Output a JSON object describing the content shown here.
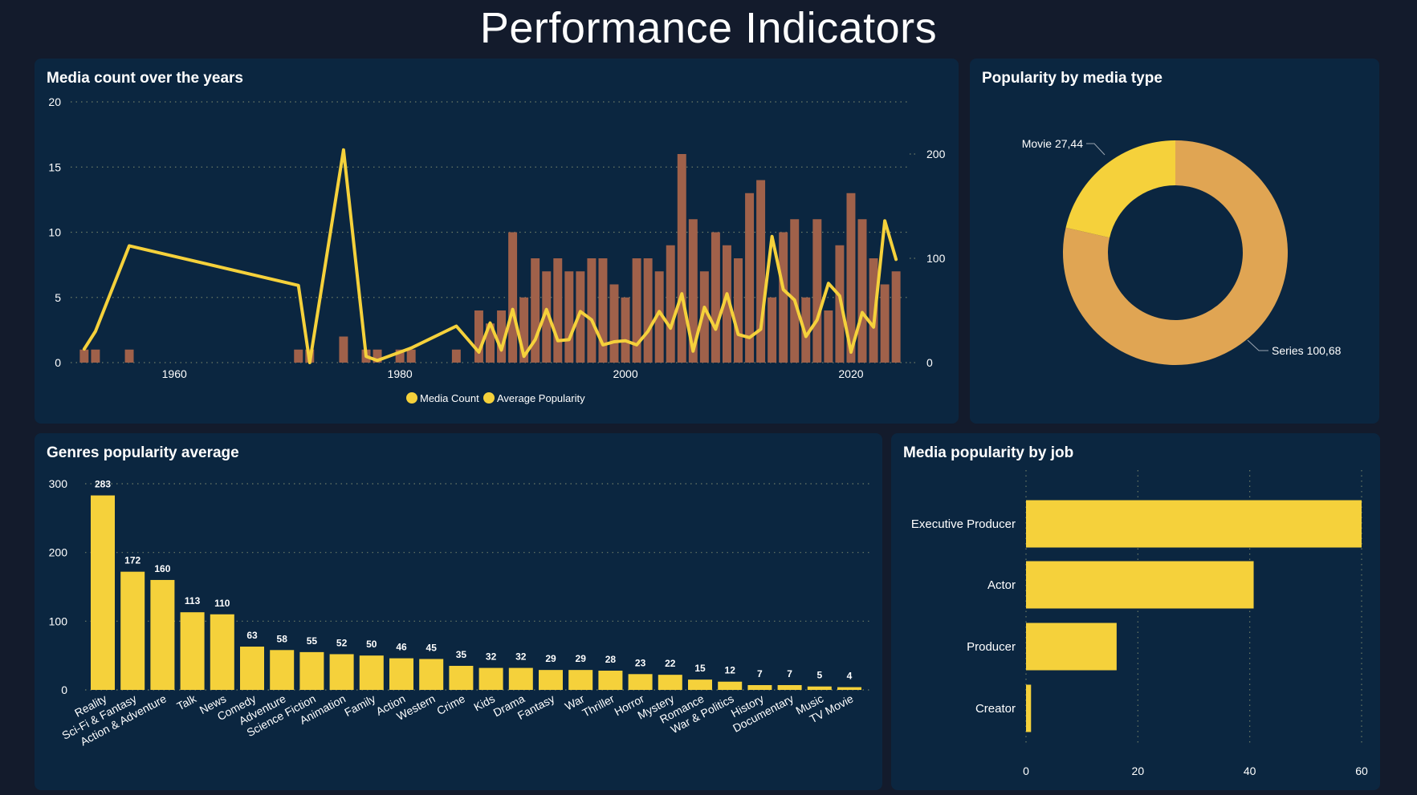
{
  "page": {
    "title": "Performance Indicators"
  },
  "panels": {
    "media_count": {
      "title": "Media count over the years"
    },
    "popularity_type": {
      "title": "Popularity by media type"
    },
    "genres": {
      "title": "Genres popularity average"
    },
    "jobs": {
      "title": "Media popularity by job"
    }
  },
  "colors": {
    "background": "#131b2c",
    "panel": "#0b2640",
    "yellow": "#f5d13b",
    "bar_brown": "#a0614a",
    "series_orange": "#e0a553",
    "grid": "#6b7a66",
    "text": "#ffffff"
  },
  "chart_data": [
    {
      "id": "media_count",
      "type": "bar",
      "title": "Media count over the years",
      "x_ticks": [
        1960,
        1980,
        2000,
        2020
      ],
      "y_ticks": [
        0,
        5,
        10,
        15,
        20
      ],
      "y_right_ticks": [
        0,
        100,
        200
      ],
      "ylim": [
        0,
        20
      ],
      "y_right_lim": [
        0,
        250
      ],
      "grid": true,
      "legend": [
        "Media Count",
        "Average Popularity"
      ],
      "legend_position": "bottom",
      "bars": [
        {
          "year": 1952,
          "value": 1
        },
        {
          "year": 1953,
          "value": 1
        },
        {
          "year": 1956,
          "value": 1
        },
        {
          "year": 1971,
          "value": 1
        },
        {
          "year": 1972,
          "value": 1
        },
        {
          "year": 1975,
          "value": 2
        },
        {
          "year": 1977,
          "value": 1
        },
        {
          "year": 1978,
          "value": 1
        },
        {
          "year": 1980,
          "value": 1
        },
        {
          "year": 1981,
          "value": 1
        },
        {
          "year": 1985,
          "value": 1
        },
        {
          "year": 1987,
          "value": 4
        },
        {
          "year": 1988,
          "value": 3
        },
        {
          "year": 1989,
          "value": 4
        },
        {
          "year": 1990,
          "value": 10
        },
        {
          "year": 1991,
          "value": 5
        },
        {
          "year": 1992,
          "value": 8
        },
        {
          "year": 1993,
          "value": 7
        },
        {
          "year": 1994,
          "value": 8
        },
        {
          "year": 1995,
          "value": 7
        },
        {
          "year": 1996,
          "value": 7
        },
        {
          "year": 1997,
          "value": 8
        },
        {
          "year": 1998,
          "value": 8
        },
        {
          "year": 1999,
          "value": 6
        },
        {
          "year": 2000,
          "value": 5
        },
        {
          "year": 2001,
          "value": 8
        },
        {
          "year": 2002,
          "value": 8
        },
        {
          "year": 2003,
          "value": 7
        },
        {
          "year": 2004,
          "value": 9
        },
        {
          "year": 2005,
          "value": 16
        },
        {
          "year": 2006,
          "value": 11
        },
        {
          "year": 2007,
          "value": 7
        },
        {
          "year": 2008,
          "value": 10
        },
        {
          "year": 2009,
          "value": 9
        },
        {
          "year": 2010,
          "value": 8
        },
        {
          "year": 2011,
          "value": 13
        },
        {
          "year": 2012,
          "value": 14
        },
        {
          "year": 2013,
          "value": 5
        },
        {
          "year": 2014,
          "value": 10
        },
        {
          "year": 2015,
          "value": 11
        },
        {
          "year": 2016,
          "value": 5
        },
        {
          "year": 2017,
          "value": 11
        },
        {
          "year": 2018,
          "value": 4
        },
        {
          "year": 2019,
          "value": 9
        },
        {
          "year": 2020,
          "value": 13
        },
        {
          "year": 2021,
          "value": 11
        },
        {
          "year": 2022,
          "value": 8
        },
        {
          "year": 2023,
          "value": 6
        },
        {
          "year": 2024,
          "value": 7
        }
      ],
      "line": [
        {
          "year": 1952,
          "value": 13
        },
        {
          "year": 1953,
          "value": 30
        },
        {
          "year": 1956,
          "value": 112
        },
        {
          "year": 1971,
          "value": 74
        },
        {
          "year": 1972,
          "value": 0
        },
        {
          "year": 1975,
          "value": 204
        },
        {
          "year": 1977,
          "value": 6
        },
        {
          "year": 1978,
          "value": 2
        },
        {
          "year": 1980,
          "value": 10
        },
        {
          "year": 1981,
          "value": 14
        },
        {
          "year": 1985,
          "value": 35
        },
        {
          "year": 1987,
          "value": 10
        },
        {
          "year": 1988,
          "value": 38
        },
        {
          "year": 1989,
          "value": 12
        },
        {
          "year": 1990,
          "value": 51
        },
        {
          "year": 1991,
          "value": 6
        },
        {
          "year": 1992,
          "value": 22
        },
        {
          "year": 1993,
          "value": 51
        },
        {
          "year": 1994,
          "value": 21
        },
        {
          "year": 1995,
          "value": 22
        },
        {
          "year": 1996,
          "value": 49
        },
        {
          "year": 1997,
          "value": 41
        },
        {
          "year": 1998,
          "value": 17
        },
        {
          "year": 1999,
          "value": 20
        },
        {
          "year": 2000,
          "value": 21
        },
        {
          "year": 2001,
          "value": 17
        },
        {
          "year": 2002,
          "value": 30
        },
        {
          "year": 2003,
          "value": 49
        },
        {
          "year": 2004,
          "value": 33
        },
        {
          "year": 2005,
          "value": 66
        },
        {
          "year": 2006,
          "value": 11
        },
        {
          "year": 2007,
          "value": 53
        },
        {
          "year": 2008,
          "value": 32
        },
        {
          "year": 2009,
          "value": 66
        },
        {
          "year": 2010,
          "value": 27
        },
        {
          "year": 2011,
          "value": 24
        },
        {
          "year": 2012,
          "value": 32
        },
        {
          "year": 2013,
          "value": 121
        },
        {
          "year": 2014,
          "value": 70
        },
        {
          "year": 2015,
          "value": 60
        },
        {
          "year": 2016,
          "value": 25
        },
        {
          "year": 2017,
          "value": 41
        },
        {
          "year": 2018,
          "value": 76
        },
        {
          "year": 2019,
          "value": 64
        },
        {
          "year": 2020,
          "value": 10
        },
        {
          "year": 2021,
          "value": 48
        },
        {
          "year": 2022,
          "value": 34
        },
        {
          "year": 2023,
          "value": 136
        },
        {
          "year": 2024,
          "value": 99
        }
      ]
    },
    {
      "id": "popularity_type",
      "type": "pie",
      "title": "Popularity by media type",
      "slices": [
        {
          "name": "Movie",
          "value": 27.44,
          "label": "Movie 27,44",
          "color": "#f5d13b"
        },
        {
          "name": "Series",
          "value": 100.68,
          "label": "Series 100,68",
          "color": "#e0a553"
        }
      ]
    },
    {
      "id": "genres",
      "type": "bar",
      "title": "Genres popularity average",
      "ylim": [
        0,
        300
      ],
      "y_ticks": [
        0,
        100,
        200,
        300
      ],
      "grid": true,
      "categories": [
        "Reality",
        "Sci-Fi & Fantasy",
        "Action & Adventure",
        "Talk",
        "News",
        "Comedy",
        "Adventure",
        "Science Fiction",
        "Animation",
        "Family",
        "Action",
        "Western",
        "Crime",
        "Kids",
        "Drama",
        "Fantasy",
        "War",
        "Thriller",
        "Horror",
        "Mystery",
        "Romance",
        "War & Politics",
        "History",
        "Documentary",
        "Music",
        "TV Movie"
      ],
      "values": [
        283,
        172,
        160,
        113,
        110,
        63,
        58,
        55,
        52,
        50,
        46,
        45,
        35,
        32,
        32,
        29,
        29,
        28,
        23,
        22,
        15,
        12,
        7,
        7,
        5,
        4
      ]
    },
    {
      "id": "jobs",
      "type": "bar",
      "title": "Media popularity by job",
      "orientation": "horizontal",
      "xlim": [
        0,
        60
      ],
      "x_ticks": [
        0,
        20,
        40,
        60
      ],
      "grid": true,
      "categories": [
        "Executive Producer",
        "Actor",
        "Producer",
        "Creator"
      ],
      "values": [
        60,
        40.7,
        16.2,
        0.9
      ]
    }
  ]
}
